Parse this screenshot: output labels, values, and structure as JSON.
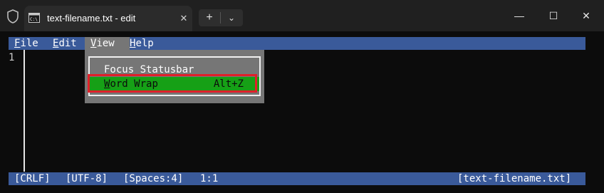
{
  "window": {
    "tab_title": "text-filename.txt - edit",
    "tab_close": "✕",
    "new_tab": "+",
    "dropdown": "⌄",
    "minimize": "—",
    "maximize": "☐",
    "close": "✕"
  },
  "menubar": {
    "file": {
      "acc": "F",
      "rest": "ile"
    },
    "edit": {
      "acc": "E",
      "rest": "dit"
    },
    "view": {
      "acc": "V",
      "rest": "iew"
    },
    "help": {
      "acc": "H",
      "rest": "elp"
    }
  },
  "editor": {
    "line_number": "1"
  },
  "view_menu": {
    "items": [
      {
        "label": "Focus Statusbar",
        "shortcut": ""
      },
      {
        "acc": "W",
        "rest": "ord Wrap",
        "shortcut": "Alt+Z",
        "selected": true
      }
    ]
  },
  "statusbar": {
    "line_ending": "[CRLF]",
    "encoding": "[UTF-8]",
    "indent": "[Spaces:4]",
    "position": "1:1",
    "filename": "[text-filename.txt]"
  },
  "colors": {
    "menubar_bg": "#3a5a9a",
    "menu_active": "#767676",
    "selected_item": "#16a016",
    "highlight_border": "#e0202a",
    "terminal_bg": "#0c0c0c"
  }
}
